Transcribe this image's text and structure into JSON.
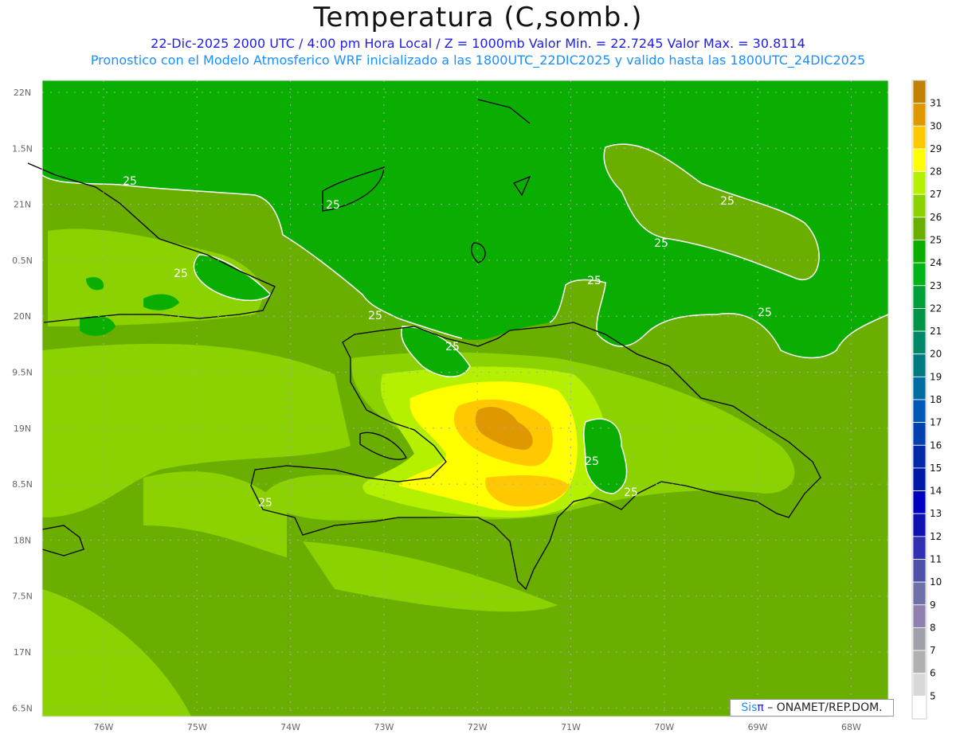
{
  "title": "Temperatura (C,somb.)",
  "subtitle_line1": "22-Dic-2025  2000 UTC / 4:00 pm Hora Local / Z = 1000mb   Valor Min. = 22.7245  Valor Max. = 30.8114",
  "subtitle_line2": "Pronostico con el Modelo Atmosferico WRF inicializado a las 1800UTC_22DIC2025 y valido hasta las  1800UTC_24DIC2025",
  "lat_labels": [
    "22N",
    "1.5N",
    "21N",
    "0.5N",
    "20N",
    "9.5N",
    "19N",
    "8.5N",
    "18N",
    "7.5N",
    "17N",
    "6.5N"
  ],
  "lon_labels": [
    "76W",
    "75W",
    "74W",
    "73W",
    "72W",
    "71W",
    "70W",
    "69W",
    "68W"
  ],
  "contour_label": "25",
  "credit": {
    "sis": "Sis",
    "pi": "π",
    "rest": " – ONAMET/REP.DOM."
  },
  "colorbar": {
    "labels": [
      "31",
      "30",
      "29",
      "28",
      "27",
      "26",
      "25",
      "24",
      "23",
      "22",
      "21",
      "20",
      "19",
      "18",
      "17",
      "16",
      "15",
      "14",
      "13",
      "12",
      "11",
      "10",
      "9",
      "8",
      "7",
      "6",
      "5"
    ],
    "colors": [
      "#c08000",
      "#e09800",
      "#ffc800",
      "#ffff00",
      "#b4f000",
      "#8cd200",
      "#6aae00",
      "#0aae00",
      "#00b418",
      "#00a038",
      "#009448",
      "#008868",
      "#007c80",
      "#006ca0",
      "#0058b8",
      "#0040b0",
      "#0028a8",
      "#0018a8",
      "#0000c0",
      "#1010b0",
      "#3030b0",
      "#5050a8",
      "#7070a8",
      "#9080b0",
      "#a0a0a8",
      "#b0b0b0",
      "#d8d8d8",
      "#ffffff"
    ]
  },
  "map_colors": {
    "t24": "#0aae00",
    "t25": "#6aae00",
    "t26": "#8cd200",
    "t27": "#b4f000",
    "t28": "#ffff00",
    "t29": "#ffc800",
    "t30": "#e09800"
  }
}
